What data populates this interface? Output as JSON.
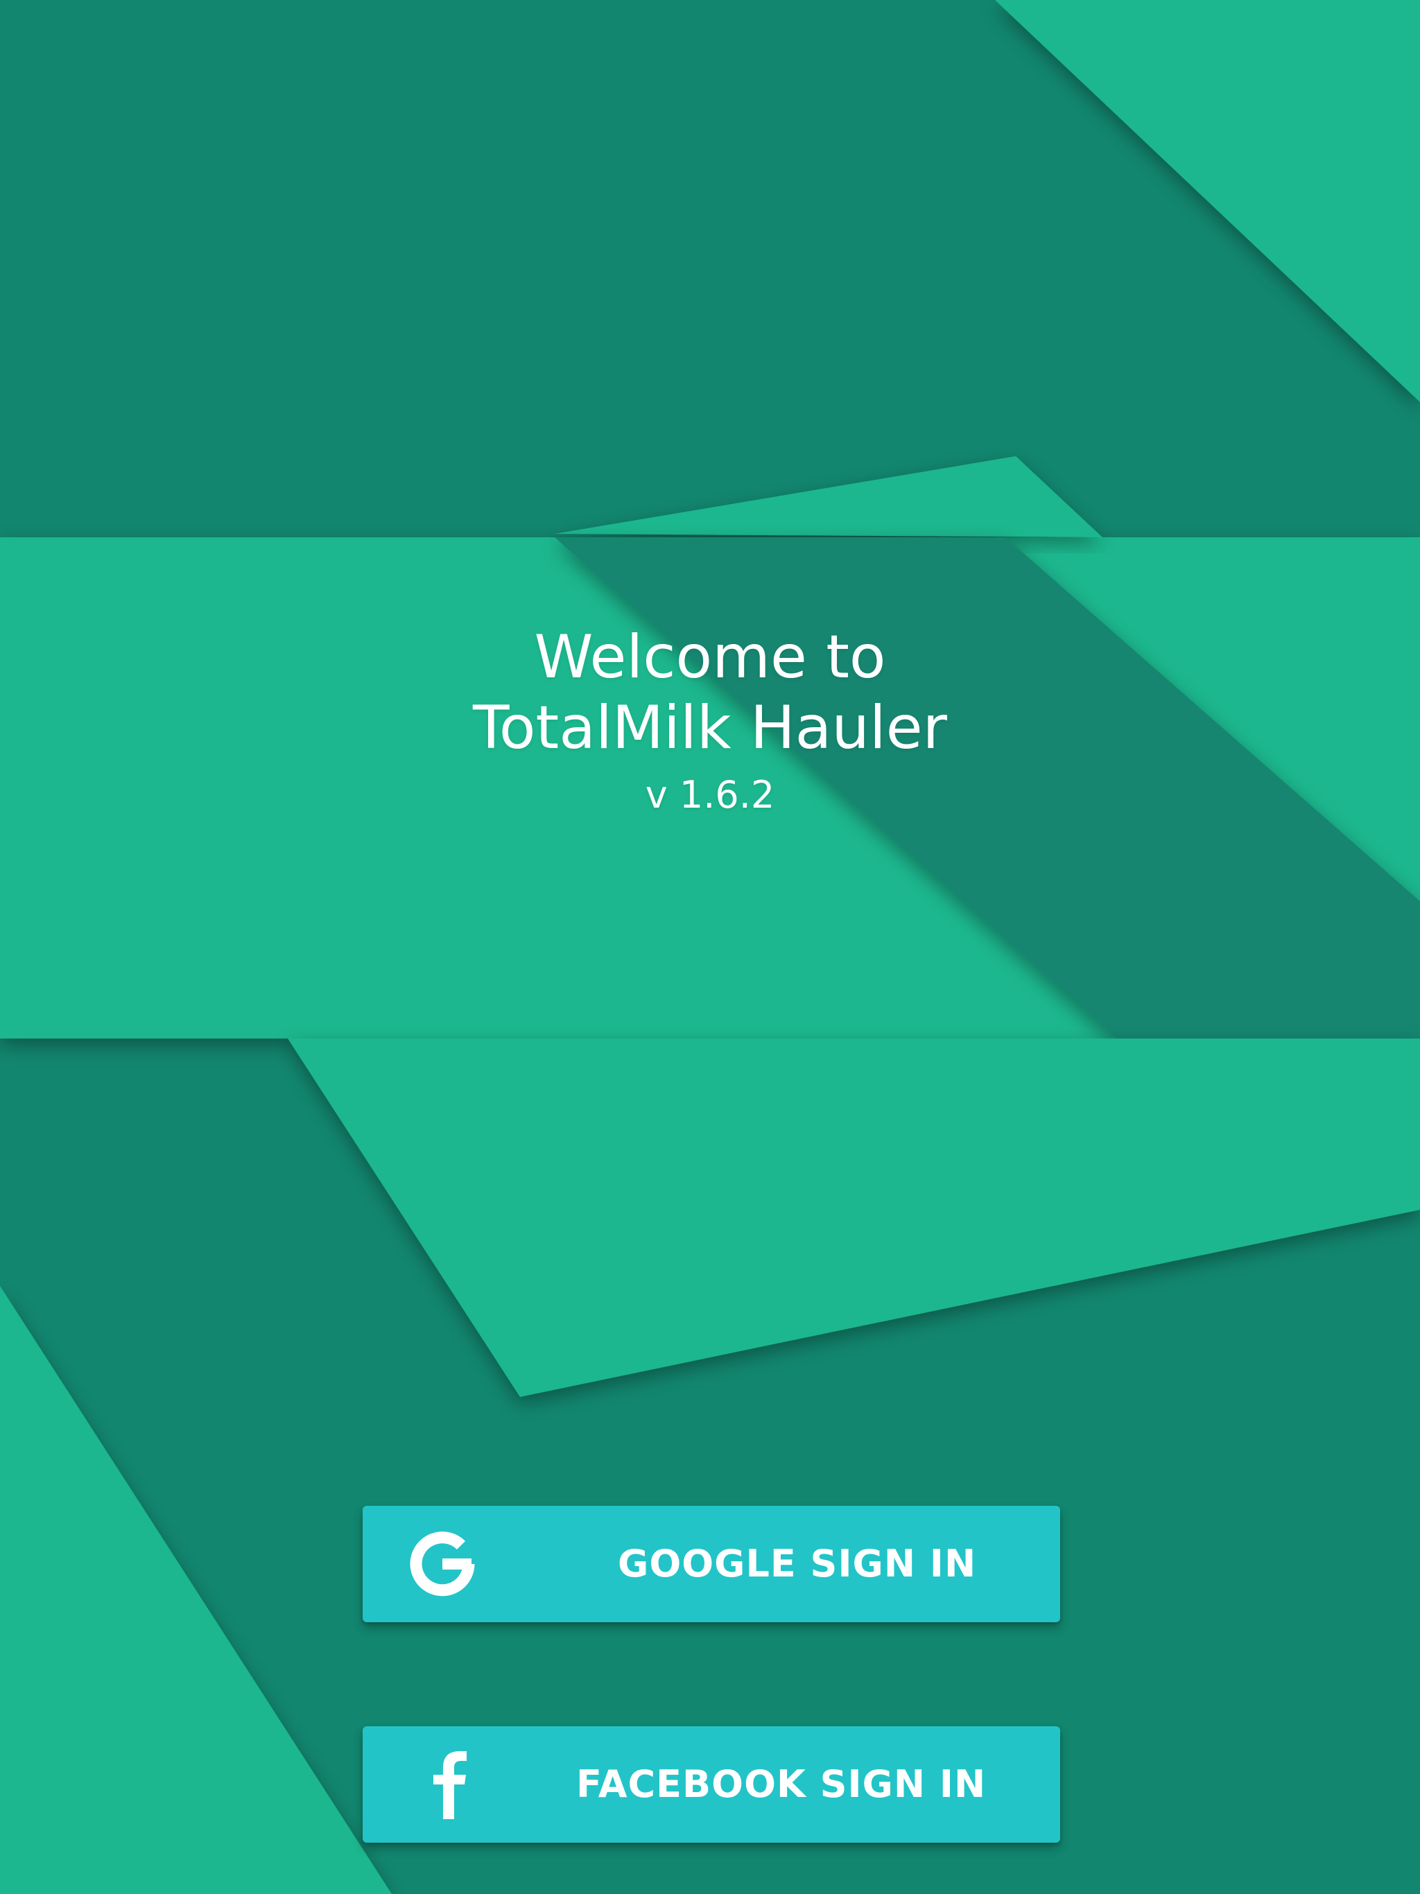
{
  "app": {
    "welcome_line1": "Welcome to",
    "welcome_line2": "TotalMilk Hauler",
    "version": "v 1.6.2"
  },
  "buttons": {
    "google": {
      "label": "GOOGLE SIGN IN",
      "icon": "google-g-icon"
    },
    "facebook": {
      "label": "FACEBOOK SIGN IN",
      "icon": "facebook-f-icon"
    }
  },
  "colors": {
    "dark_teal": "#12866f",
    "light_teal": "#1fb78e",
    "button": "#22c4c8",
    "text": "#ffffff"
  }
}
